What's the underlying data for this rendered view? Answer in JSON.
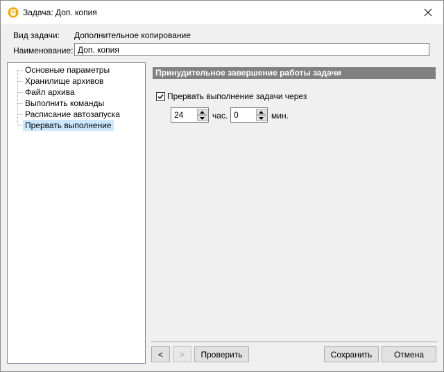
{
  "window": {
    "title": "Задача: Доп. копия",
    "accent": "#f5a800"
  },
  "fields": {
    "task_type_label": "Вид задачи:",
    "task_type_value": "Дополнительное копирование",
    "name_label": "Наименование:",
    "name_value": "Доп. копия"
  },
  "tree": {
    "items": [
      {
        "label": "Основные параметры"
      },
      {
        "label": "Хранилище архивов"
      },
      {
        "label": "Файл архива"
      },
      {
        "label": "Выполнить команды"
      },
      {
        "label": "Расписание автозапуска"
      },
      {
        "label": "Прервать выполнение"
      }
    ],
    "selected_index": 5
  },
  "panel": {
    "header": "Принудительное завершение работы задачи",
    "checkbox_label": "Прервать выполнение задачи через",
    "checkbox_checked": true,
    "hours_value": "24",
    "hours_unit": "час.",
    "minutes_value": "0",
    "minutes_unit": "мин."
  },
  "buttons": {
    "back": "<",
    "forward": ">",
    "check": "Проверить",
    "save": "Сохранить",
    "cancel": "Отмена"
  }
}
